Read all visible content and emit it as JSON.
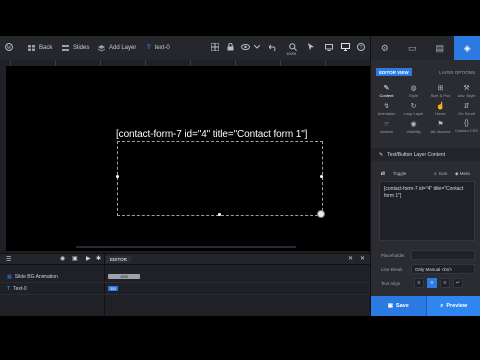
{
  "toolbar": {
    "back": "Back",
    "slides": "Slides",
    "add_layer": "Add Layer",
    "layer_name": "text-0",
    "zoom": "100%"
  },
  "canvas": {
    "shortcode": "[contact-form-7 id=\"4\" title=\"Contact form 1\"]"
  },
  "timeline": {
    "editor_tab": "EDITOR",
    "rows": [
      {
        "label": "Slide BG Animation",
        "bar": "1000"
      },
      {
        "label": "Text-0",
        "bar": "300"
      }
    ]
  },
  "panel": {
    "editor_view": "EDITOR VIEW",
    "layer_options": "LAYER OPTIONS",
    "grid": [
      {
        "label": "Content",
        "icon": "pencil-icon"
      },
      {
        "label": "Style",
        "icon": "brush-icon"
      },
      {
        "label": "Size & Pos",
        "icon": "size-icon"
      },
      {
        "label": "Adv. Style",
        "icon": "adv-style-icon"
      },
      {
        "label": "Animation",
        "icon": "animation-icon"
      },
      {
        "label": "Loop Layer",
        "icon": "loop-icon"
      },
      {
        "label": "Hover",
        "icon": "hover-icon"
      },
      {
        "label": "On Scroll",
        "icon": "scroll-icon"
      },
      {
        "label": "Actions",
        "icon": "actions-icon"
      },
      {
        "label": "Visibility",
        "icon": "visibility-icon"
      },
      {
        "label": "Att./Access",
        "icon": "access-icon"
      },
      {
        "label": "Custom CSS",
        "icon": "css-icon"
      }
    ],
    "section_title": "Text/Button Layer Content",
    "subtabs": {
      "toggle": "Toggle",
      "icon": "Icon",
      "meta": "Meta"
    },
    "content_text": "[contact-form-7 id=\"4\" title=\"Contact form 1\"]",
    "placeholder_label": "Placeholder",
    "line_break_label": "Line Break",
    "line_break_value": "Only Manual <br/>",
    "text_align_label": "Text Align",
    "save": "Save",
    "preview": "Preview"
  },
  "colors": {
    "accent": "#2a7ae2",
    "bg": "#1b1d22"
  }
}
